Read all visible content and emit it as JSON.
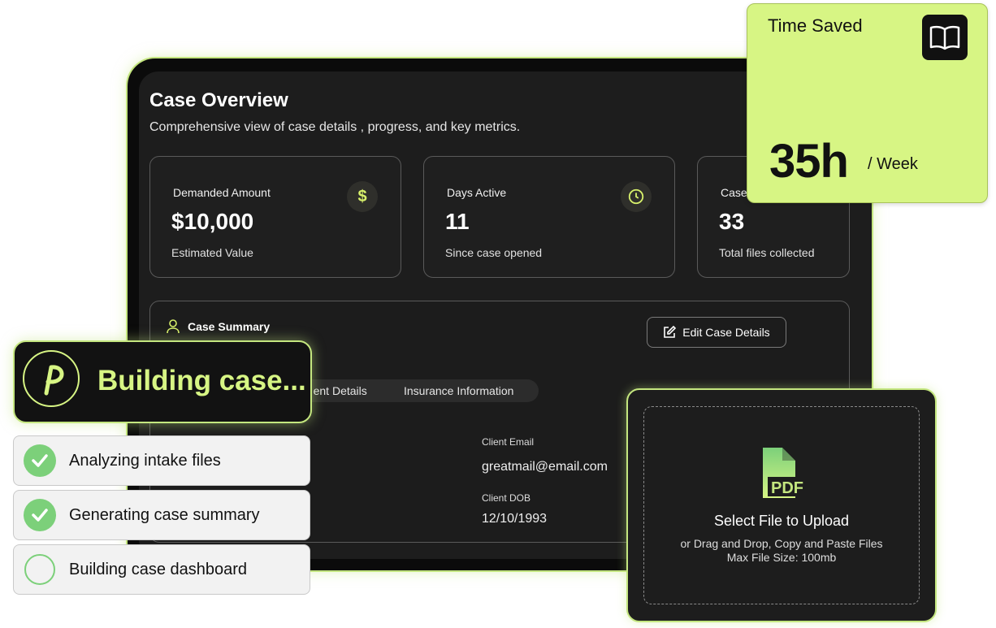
{
  "overview": {
    "title": "Case Overview",
    "subtitle": "Comprehensive view of case details , progress, and key metrics."
  },
  "metrics": [
    {
      "label": "Demanded Amount",
      "value": "$10,000",
      "caption": "Estimated Value",
      "icon": "dollar-icon"
    },
    {
      "label": "Days Active",
      "value": "11",
      "caption": "Since case opened",
      "icon": "clock-icon"
    },
    {
      "label": "Case",
      "value": "33",
      "caption": "Total files collected"
    }
  ],
  "summary": {
    "title": "Case Summary",
    "edit_label": "Edit Case Details",
    "tabs": [
      "ent Details",
      "Insurance Information"
    ],
    "fields": {
      "email_label": "Client Email",
      "email_value": "greatmail@email.com",
      "dob_label": "Client DOB",
      "dob_value": "12/10/1993"
    }
  },
  "time_saved": {
    "title": "Time Saved",
    "value": "35h",
    "unit": "/ Week",
    "icon": "book-icon"
  },
  "building": {
    "text": "Building case...",
    "steps": [
      {
        "label": "Analyzing intake files",
        "status": "done"
      },
      {
        "label": "Generating case summary",
        "status": "done"
      },
      {
        "label": "Building case dashboard",
        "status": "in-progress"
      }
    ]
  },
  "upload": {
    "title": "Select File to Upload",
    "subtitle": "or Drag and Drop, Copy and Paste Files",
    "size": "Max File Size: 100mb",
    "icon": "pdf-icon"
  },
  "colors": {
    "accent": "#d7f584",
    "success": "#7cd07a",
    "dark": "#1d1d1d"
  }
}
